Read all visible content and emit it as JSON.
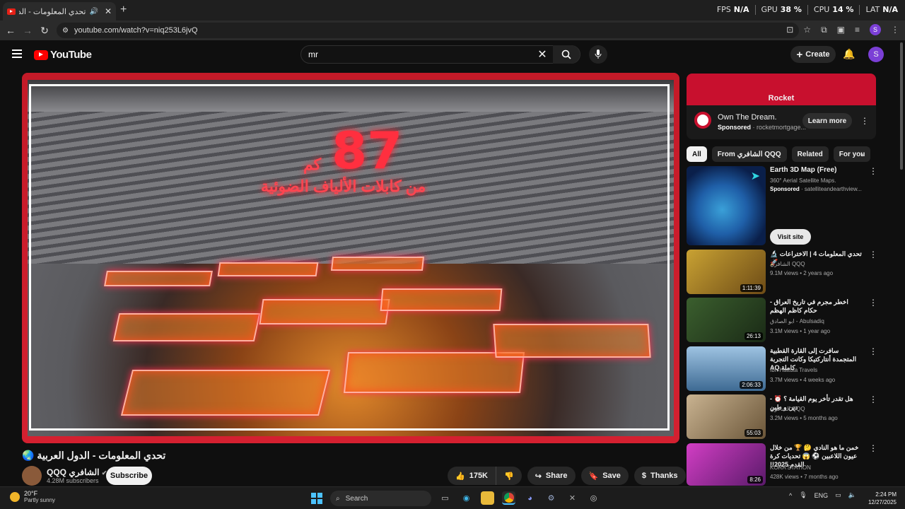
{
  "browser": {
    "tab_title": "تحدي المعلومات - الدول العربية",
    "url": "youtube.com/watch?v=niq253L6jvQ",
    "perf": {
      "fps_label": "FPS",
      "fps": "N/A",
      "gpu_label": "GPU",
      "gpu": "38 %",
      "cpu_label": "CPU",
      "cpu": "14 %",
      "lat_label": "LAT",
      "lat": "N/A"
    },
    "profile_initial": "S"
  },
  "header": {
    "logo": "YouTube",
    "search_query": "mr",
    "create_label": "Create",
    "avatar_initial": "S"
  },
  "video": {
    "overlay_number": "87",
    "overlay_unit": "كم",
    "overlay_text": "من كابلات الألياف الضوئية",
    "title": "تحدي المعلومات - الدول العربية 🌏",
    "channel_name": "QQQ الشافري",
    "subscribers": "4.28M subscribers",
    "subscribe_label": "Subscribe",
    "likes": "175K",
    "share_label": "Share",
    "save_label": "Save",
    "thanks_label": "Thanks"
  },
  "ad": {
    "brand": "Rocket",
    "title": "Own The Dream.",
    "sponsored": "Sponsored",
    "domain": "rocketmortgage...",
    "cta": "Learn more"
  },
  "chips": [
    "All",
    "From الشافري QQQ",
    "Related",
    "For you"
  ],
  "sidebar_ad": {
    "title": "Earth 3D Map (Free)",
    "desc": "360° Aerial Satellite Maps.",
    "sponsored": "Sponsored",
    "domain": "satelliteandearthview...",
    "cta": "Visit site"
  },
  "recommendations": [
    {
      "title": "تحدي المعلومات 4 | الاختراعات 🔬🚀",
      "channel": "الشافري QQQ",
      "meta": "9.1M views • 2 years ago",
      "duration": "1:11:39",
      "color": "#c9a233"
    },
    {
      "title": "اخطر مجرم في تاريخ العراق - حكام كاظم الهظم",
      "channel": "ابو الصادق - Abulsadiq",
      "meta": "3.1M views • 1 year ago",
      "duration": "26:13",
      "color": "#3b5f2e"
    },
    {
      "title": "سافرت إلى القارة القطبية المتجمدة أنتاركتيكا وكانت التجربة كاملة AQ",
      "channel": "Ibn Hattuta Travels",
      "meta": "3.7M views • 4 weeks ago",
      "duration": "2:06:33",
      "color": "#6b93b8"
    },
    {
      "title": "هل تقدر تأخر يوم القيامة ؟ ⏰ - دين و طين",
      "channel": "الشافري QQQ",
      "meta": "3.2M views • 5 months ago",
      "duration": "55:03",
      "color": "#8a7256"
    },
    {
      "title": "خمن ما هو النادي 🤔 🏆 من خلال عيون اللاعبين ⚽ 😱 تحديات كرة القدم 2025!!",
      "channel": "KORA STATION",
      "meta": "428K views • 7 months ago",
      "duration": "8:26",
      "color": "#b02aa8"
    }
  ],
  "taskbar": {
    "temp": "20°F",
    "weather": "Partly sunny",
    "search_label": "Search",
    "lang": "ENG",
    "time": "2:24 PM",
    "date": "12/27/2025"
  }
}
